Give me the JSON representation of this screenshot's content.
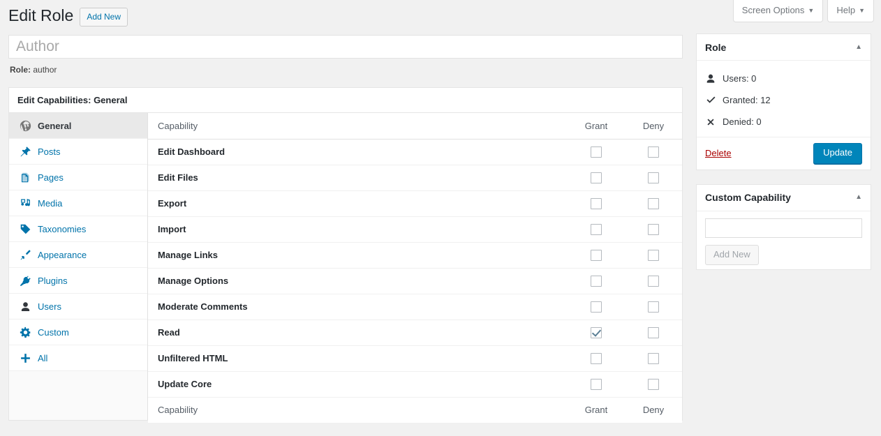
{
  "screen_meta": {
    "tabs": [
      {
        "label": "Screen Options",
        "caret": "▼"
      },
      {
        "label": "Help",
        "caret": "▼"
      }
    ]
  },
  "header": {
    "title": "Edit Role",
    "add_new_label": "Add New"
  },
  "role_form": {
    "name_value": "Author",
    "name_placeholder": "Author",
    "slug_label": "Role:",
    "slug_value": "author"
  },
  "main": {
    "panel_heading": "Edit Capabilities: General",
    "nav": [
      {
        "label": "General",
        "icon": "wordpress-icon",
        "active": true
      },
      {
        "label": "Posts",
        "icon": "pin-icon",
        "active": false
      },
      {
        "label": "Pages",
        "icon": "pages-icon",
        "active": false
      },
      {
        "label": "Media",
        "icon": "media-icon",
        "active": false
      },
      {
        "label": "Taxonomies",
        "icon": "tag-icon",
        "active": false
      },
      {
        "label": "Appearance",
        "icon": "brush-icon",
        "active": false
      },
      {
        "label": "Plugins",
        "icon": "plugin-icon",
        "active": false
      },
      {
        "label": "Users",
        "icon": "user-icon",
        "active": false
      },
      {
        "label": "Custom",
        "icon": "gear-icon",
        "active": false
      },
      {
        "label": "All",
        "icon": "plus-icon",
        "active": false
      }
    ],
    "table": {
      "columns": [
        "Capability",
        "Grant",
        "Deny"
      ],
      "rows": [
        {
          "capability": "Edit Dashboard",
          "grant": false,
          "deny": false
        },
        {
          "capability": "Edit Files",
          "grant": false,
          "deny": false
        },
        {
          "capability": "Export",
          "grant": false,
          "deny": false
        },
        {
          "capability": "Import",
          "grant": false,
          "deny": false
        },
        {
          "capability": "Manage Links",
          "grant": false,
          "deny": false
        },
        {
          "capability": "Manage Options",
          "grant": false,
          "deny": false
        },
        {
          "capability": "Moderate Comments",
          "grant": false,
          "deny": false
        },
        {
          "capability": "Read",
          "grant": true,
          "deny": false
        },
        {
          "capability": "Unfiltered HTML",
          "grant": false,
          "deny": false
        },
        {
          "capability": "Update Core",
          "grant": false,
          "deny": false
        }
      ]
    }
  },
  "sidebar": {
    "role_box": {
      "title": "Role",
      "toggle": "▲",
      "stats": [
        {
          "icon": "user-icon",
          "label": "Users: 0"
        },
        {
          "icon": "check-icon",
          "label": "Granted: 12"
        },
        {
          "icon": "cross-icon",
          "label": "Denied: 0"
        }
      ],
      "delete_label": "Delete",
      "update_label": "Update"
    },
    "custom_capability_box": {
      "title": "Custom Capability",
      "toggle": "▲",
      "input_value": "",
      "input_placeholder": "",
      "add_new_label": "Add New"
    }
  },
  "colors": {
    "accent": "#0073aa",
    "button": "#0085ba",
    "delete": "#a00",
    "background": "#f1f1f1",
    "check": "#5b7f95"
  }
}
